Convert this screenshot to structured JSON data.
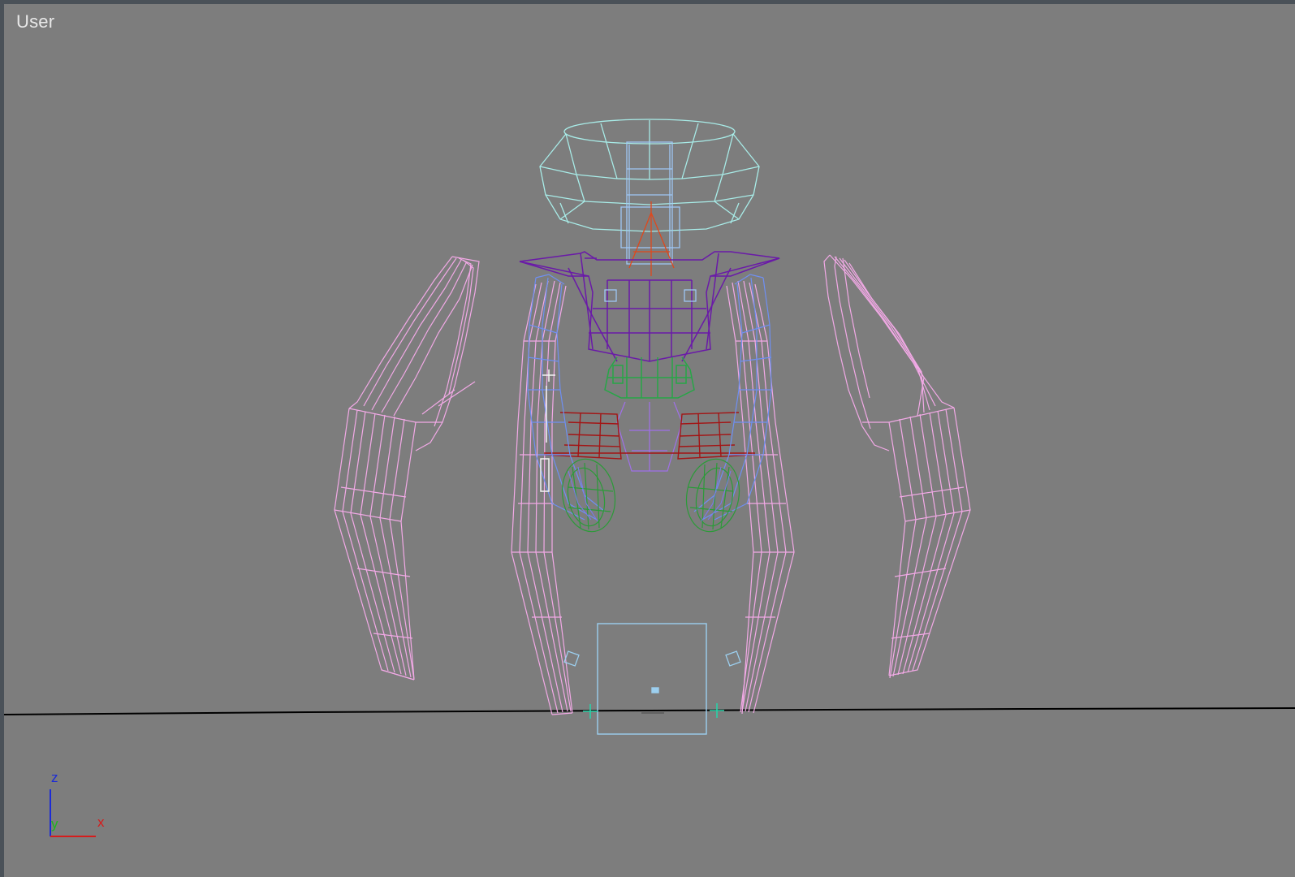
{
  "viewport": {
    "label": "User",
    "background": "#7d7d7d",
    "grid_line_color": "#000000"
  },
  "axis_tripod": {
    "z": "z",
    "y": "y",
    "x": "x",
    "z_color": "#1c2bd6",
    "y_color": "#1eb41e",
    "x_color": "#d61c1c"
  },
  "wireframe_colors": {
    "legs": "#f2a9e6",
    "head": "#a8ece8",
    "neck": "#9fc7f5",
    "torso": "#6a1aa8",
    "pelvis": "#27a647",
    "hips": "#a31515",
    "arms": "#6f8ff2",
    "hands": "#2b9b38",
    "root_box": "#9ccfef",
    "center_bone": "#e0481b"
  }
}
